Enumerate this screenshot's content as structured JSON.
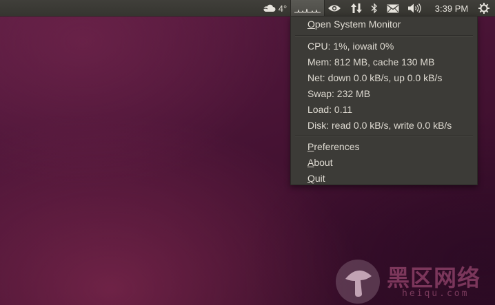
{
  "panel": {
    "weather": {
      "icon": "cloud-icon",
      "temperature": "4°"
    },
    "system_monitor": {
      "icon": "activity-graph-icon"
    },
    "indicators": [
      "eye-icon",
      "network-updown-icon",
      "bluetooth-icon",
      "mail-icon",
      "volume-icon"
    ],
    "clock": "3:39 PM",
    "session": {
      "icon": "gear-icon"
    }
  },
  "menu": {
    "open_monitor": {
      "mnemonic": "O",
      "rest": "pen System Monitor"
    },
    "stats": {
      "cpu": "CPU: 1%, iowait 0%",
      "mem": "Mem: 812 MB, cache 130 MB",
      "net": "Net: down 0.0 kB/s, up 0.0 kB/s",
      "swap": "Swap: 232 MB",
      "load": "Load: 0.11",
      "disk": "Disk: read 0.0 kB/s, write 0.0 kB/s"
    },
    "preferences": {
      "mnemonic": "P",
      "rest": "references"
    },
    "about": {
      "mnemonic": "A",
      "rest": "bout"
    },
    "quit": {
      "mnemonic": "Q",
      "rest": "uit"
    }
  },
  "watermark": {
    "text": "黑区网络",
    "url": "heiqu.com"
  },
  "colors": {
    "panel": "#3c3b37",
    "menu_bg": "#3c3b37",
    "menu_text": "#dfdbd2",
    "wallpaper": "#4a1436"
  }
}
